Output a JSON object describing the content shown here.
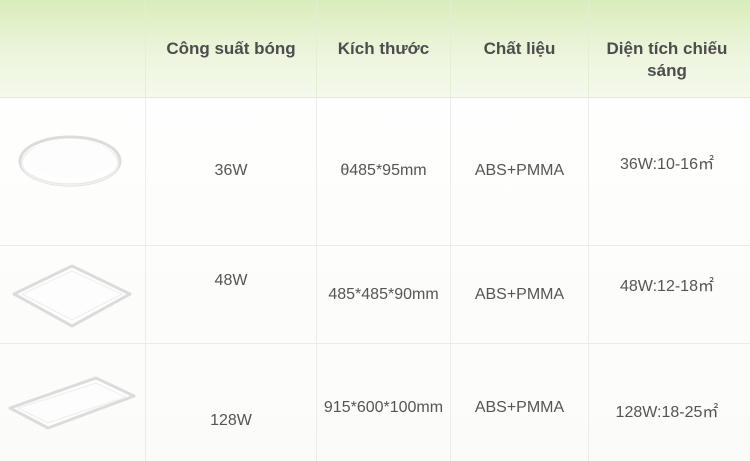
{
  "headers": {
    "power": "Công suất bóng",
    "size": "Kích thước",
    "material": "Chất liệu",
    "area": "Diện tích chiếu sáng"
  },
  "rows": [
    {
      "lamp_icon": "round-ceiling-lamp-icon",
      "power": "36W",
      "size": "θ485*95mm",
      "material": "ABS+PMMA",
      "area": "36W:10-16㎡"
    },
    {
      "lamp_icon": "square-ceiling-lamp-icon",
      "power": "48W",
      "size": "485*485*90mm",
      "material": "ABS+PMMA",
      "area": "48W:12-18㎡"
    },
    {
      "lamp_icon": "rectangular-ceiling-lamp-icon",
      "power": "128W",
      "size": "915*600*100mm",
      "material": "ABS+PMMA",
      "area": "128W:18-25㎡"
    }
  ],
  "colors": {
    "header_band": "#d9edbb",
    "text": "#4d4d4d",
    "grid": "#ebebeb"
  }
}
